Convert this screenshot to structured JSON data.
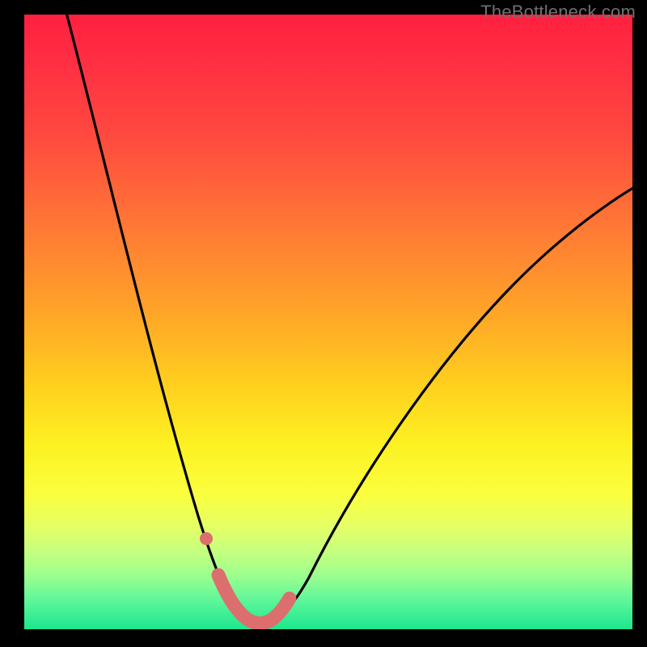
{
  "watermark": "TheBottleneck.com",
  "colors": {
    "background": "#000000",
    "curve": "#000000",
    "marker": "#dd6e6e",
    "gradient_top": "#ff203f",
    "gradient_bottom": "#1be78f"
  },
  "chart_data": {
    "type": "line",
    "title": "",
    "xlabel": "",
    "ylabel": "",
    "xlim": [
      0,
      100
    ],
    "ylim": [
      0,
      100
    ],
    "grid": false,
    "series": [
      {
        "name": "bottleneck-curve",
        "x": [
          5,
          10,
          15,
          20,
          25,
          28,
          30,
          33,
          36,
          38,
          40,
          45,
          50,
          55,
          60,
          65,
          70,
          75,
          80,
          90,
          100
        ],
        "y": [
          100,
          83,
          66,
          49,
          31,
          19,
          12,
          5,
          1,
          0,
          1,
          6,
          13,
          21,
          28,
          34,
          40,
          45,
          50,
          58,
          65
        ]
      }
    ],
    "annotations": [
      {
        "name": "marker-left-dot",
        "x": 29,
        "y": 16
      },
      {
        "name": "marker-trough-segment",
        "x_range": [
          32,
          42
        ],
        "y_range": [
          0,
          3
        ]
      }
    ],
    "legend": false
  }
}
